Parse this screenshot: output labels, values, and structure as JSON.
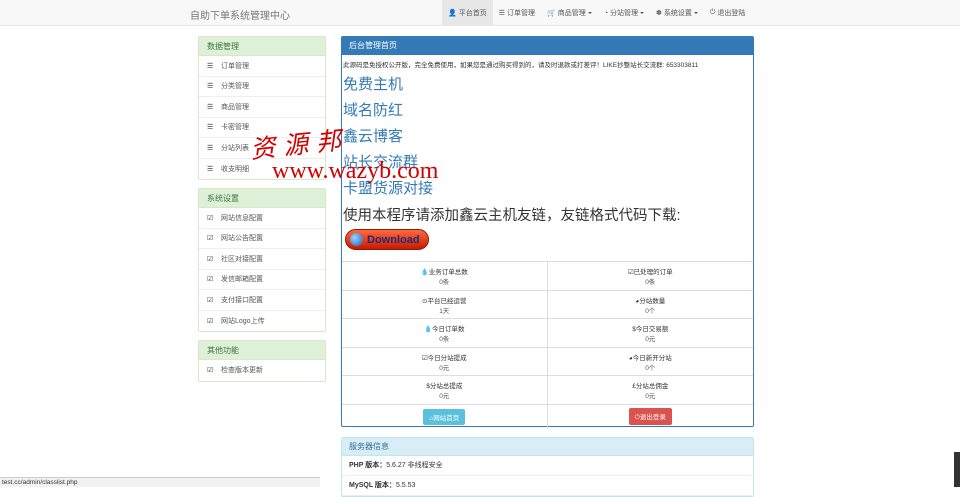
{
  "brand": "自助下单系统管理中心",
  "nav": [
    {
      "icon": "👤",
      "label": "平台首页",
      "active": true,
      "caret": false
    },
    {
      "icon": "☰",
      "label": "订单管理",
      "active": false,
      "caret": false
    },
    {
      "icon": "🛒",
      "label": "商品管理",
      "active": false,
      "caret": true
    },
    {
      "icon": "◔",
      "label": "分站管理",
      "active": false,
      "caret": true
    },
    {
      "icon": "✽",
      "label": "系统设置",
      "active": false,
      "caret": true
    },
    {
      "icon": "⏻",
      "label": "退出登陆",
      "active": false,
      "caret": false
    }
  ],
  "sidebar": {
    "data": {
      "title": "数据管理",
      "items": [
        "订单管理",
        "分类管理",
        "商品管理",
        "卡密管理",
        "分站列表",
        "收支明细"
      ]
    },
    "system": {
      "title": "系统设置",
      "items": [
        "网站信息配置",
        "网站公告配置",
        "社区对接配置",
        "发信邮箱配置",
        "支付接口配置",
        "网站Logo上传"
      ]
    },
    "other": {
      "title": "其他功能",
      "items": [
        "检查版本更新"
      ]
    }
  },
  "main": {
    "title": "后台管理首页",
    "notice": "此源码是免授权公开版，完全免费使用，如果您是通过购买得到的，请及时退款或打差评！LIKE抄整站长交流群: 653303811",
    "links": [
      "免费主机",
      "域名防红",
      "鑫云博客",
      "站长交流群",
      "卡盟货源对接"
    ],
    "friend_text": "使用本程序请添加鑫云主机友链，友链格式代码下载:",
    "download_label": "Download",
    "stats": [
      [
        {
          "icon": "💧",
          "label": "业务订单总数",
          "value": "0条"
        },
        {
          "icon": "☑",
          "label": "已处理的订单",
          "value": "0条"
        }
      ],
      [
        {
          "icon": "⊙",
          "label": "平台已经运营",
          "value": "1天"
        },
        {
          "icon": "◕",
          "label": "分站数量",
          "value": "0个"
        }
      ],
      [
        {
          "icon": "💧",
          "label": "今日订单数",
          "value": "0条"
        },
        {
          "icon": "$",
          "label": "今日交易额",
          "value": "0元"
        }
      ],
      [
        {
          "icon": "☑",
          "label": "今日分站提成",
          "value": "0元"
        },
        {
          "icon": "◕",
          "label": "今日新开分站",
          "value": "0个"
        }
      ],
      [
        {
          "icon": "$",
          "label": "分站总提成",
          "value": "0元"
        },
        {
          "icon": "£",
          "label": "分站总佣金",
          "value": "0元"
        }
      ]
    ],
    "buttons": {
      "home": "网站首页",
      "logout": "退出登录"
    }
  },
  "server": {
    "title": "服务器信息",
    "rows": [
      {
        "key": "PHP 版本：",
        "value": "5.6.27 非线程安全"
      },
      {
        "key": "MySQL 版本：",
        "value": "5.5.53"
      }
    ]
  },
  "watermark": {
    "cn": "资源邦",
    "url": "www.wazyb.com"
  },
  "status_url": "test.cc/admin/classlist.php",
  "colors": {
    "primary": "#337ab7",
    "success_bg": "#dff0d8",
    "info_bg": "#d9edf7",
    "danger": "#d9534f",
    "info": "#5bc0de",
    "watermark": "#d40000"
  }
}
